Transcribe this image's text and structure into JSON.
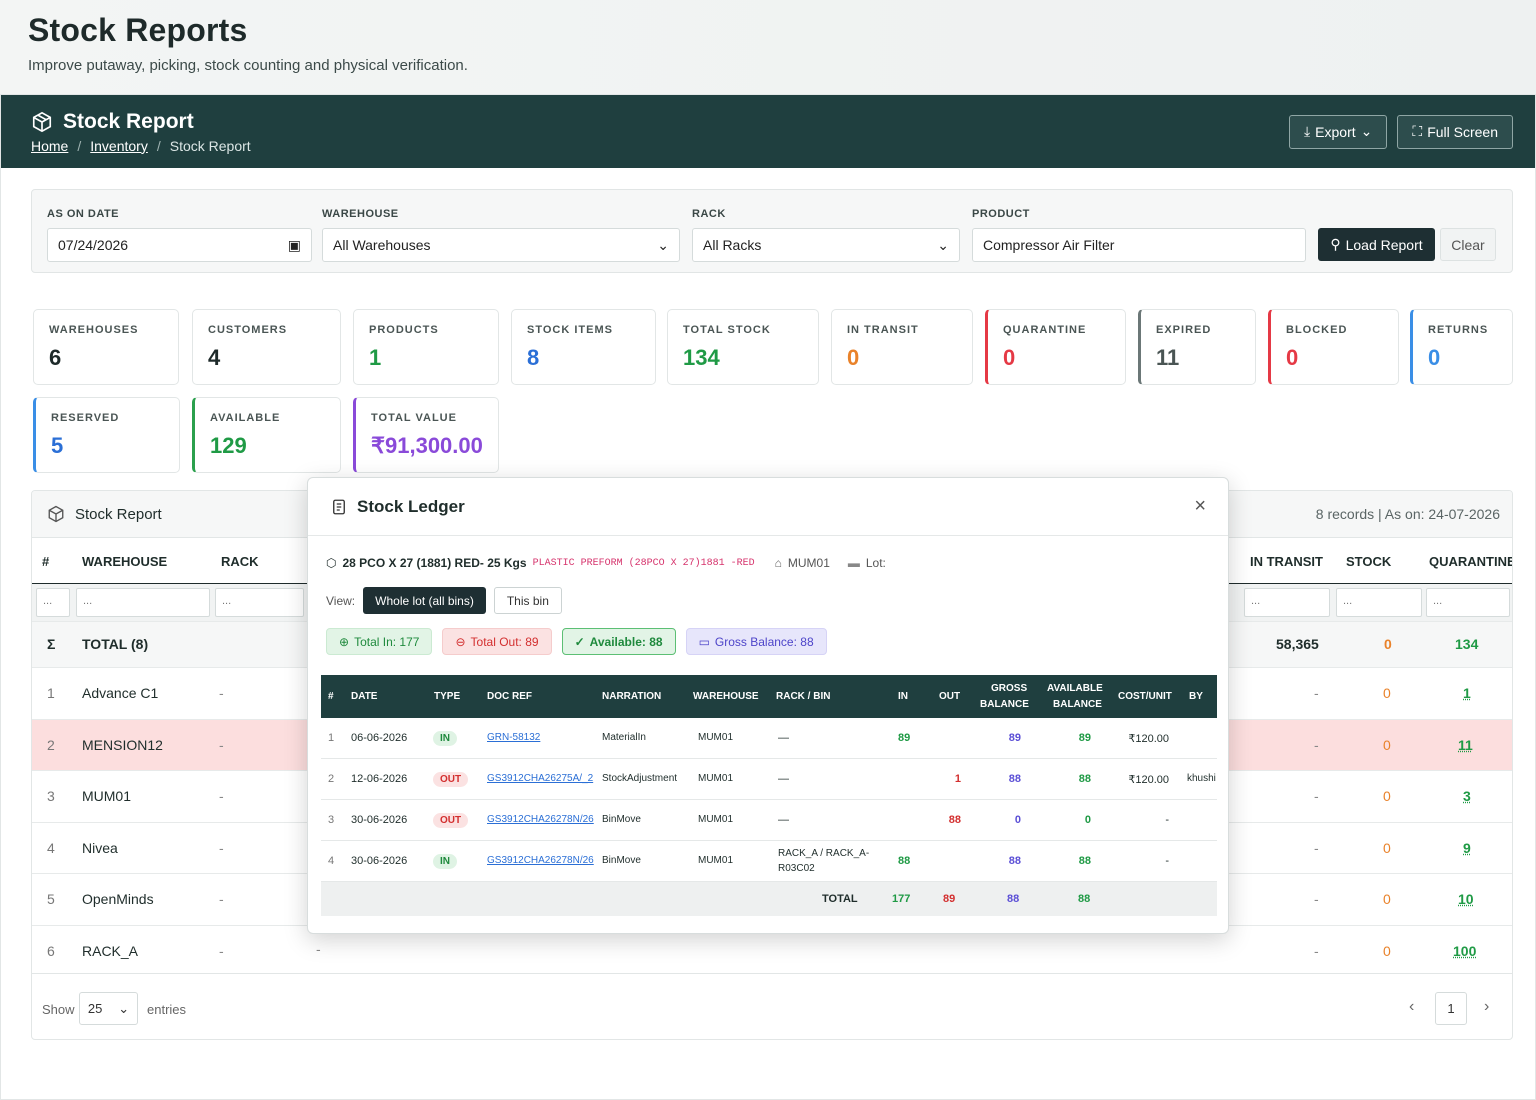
{
  "page": {
    "title": "Stock Reports",
    "subtitle": "Improve putaway, picking, stock counting and physical verification."
  },
  "header": {
    "title": "Stock Report",
    "breadcrumbs": [
      "Home",
      "Inventory",
      "Stock Report"
    ],
    "export_label": "Export",
    "fullscreen_label": "Full Screen"
  },
  "filters": {
    "date": {
      "label": "AS ON DATE",
      "value": "07/24/2026"
    },
    "warehouse": {
      "label": "WAREHOUSE",
      "value": "All Warehouses"
    },
    "rack": {
      "label": "RACK",
      "value": "All Racks"
    },
    "product": {
      "label": "PRODUCT",
      "value": "Compressor Air Filter"
    },
    "load_label": "Load Report",
    "clear_label": "Clear"
  },
  "stats": [
    {
      "label": "WAREHOUSES",
      "value": "6",
      "color": "#1e2a2a"
    },
    {
      "label": "CUSTOMERS",
      "value": "4",
      "color": "#1e2a2a"
    },
    {
      "label": "PRODUCTS",
      "value": "1",
      "color": "#1f9a45"
    },
    {
      "label": "STOCK ITEMS",
      "value": "8",
      "color": "#2b6fd6"
    },
    {
      "label": "TOTAL STOCK",
      "value": "134",
      "color": "#1f9a45"
    },
    {
      "label": "IN TRANSIT",
      "value": "0",
      "color": "#e9822a"
    },
    {
      "label": "QUARANTINE",
      "value": "0",
      "color": "#e53945"
    },
    {
      "label": "EXPIRED",
      "value": "11",
      "color": "#4a5554"
    },
    {
      "label": "BLOCKED",
      "value": "0",
      "color": "#e53945"
    },
    {
      "label": "RETURNS",
      "value": "0",
      "color": "#3a8ee6"
    },
    {
      "label": "RESERVED",
      "value": "5",
      "color": "#2b6fd6"
    },
    {
      "label": "AVAILABLE",
      "value": "129",
      "color": "#1f9a45"
    },
    {
      "label": "TOTAL VALUE",
      "value": "₹91,300.00",
      "color": "#8a4ad9"
    }
  ],
  "report": {
    "title": "Stock Report",
    "meta": "8 records | As on: 24-07-2026",
    "columns": {
      "num": "#",
      "warehouse": "WAREHOUSE",
      "rack": "RACK",
      "in_transit": "IN TRANSIT",
      "stock": "STOCK",
      "quarantine": "QUARANTINE"
    },
    "search_placeholder": "...",
    "total": {
      "sigma": "Σ",
      "label": "TOTAL (8)",
      "value": "58,365",
      "transit": "0",
      "qty": "134"
    },
    "rows": [
      {
        "n": "1",
        "wh": "Advance C1",
        "rack": "-",
        "dash": "-",
        "transit": "0",
        "qty": "1"
      },
      {
        "n": "2",
        "wh": "MENSION12",
        "rack": "-",
        "dash": "-",
        "transit": "0",
        "qty": "11"
      },
      {
        "n": "3",
        "wh": "MUM01",
        "rack": "-",
        "dash": "-",
        "transit": "0",
        "qty": "3"
      },
      {
        "n": "4",
        "wh": "Nivea",
        "rack": "-",
        "dash": "-",
        "transit": "0",
        "qty": "9"
      },
      {
        "n": "5",
        "wh": "OpenMinds",
        "rack": "-",
        "dash": "-",
        "transit": "0",
        "qty": "10"
      },
      {
        "n": "6",
        "wh": "RACK_A",
        "rack": "-",
        "dash": "-",
        "transit": "0",
        "qty": "100"
      }
    ],
    "extra_dash": "-",
    "show_label": "Show",
    "page_size": "25",
    "entries_label": "entries",
    "page": "1"
  },
  "ledger": {
    "title": "Stock Ledger",
    "product_name": "28 PCO X 27 (1881) RED- 25 Kgs",
    "product_code": "PLASTIC PREFORM (28PCO X 27)1881 -RED",
    "warehouse": "MUM01",
    "lot_label": "Lot:",
    "view_label": "View:",
    "view_whole": "Whole lot (all bins)",
    "view_bin": "This bin",
    "total_in": "Total In: 177",
    "total_out": "Total Out: 89",
    "available": "Available: 88",
    "gross_balance": "Gross Balance: 88",
    "columns": {
      "num": "#",
      "date": "DATE",
      "type": "TYPE",
      "doc": "DOC REF",
      "narration": "NARRATION",
      "warehouse": "WAREHOUSE",
      "rack": "RACK / BIN",
      "in": "IN",
      "out": "OUT",
      "gross1": "GROSS",
      "gross2": "BALANCE",
      "avail1": "AVAILABLE",
      "avail2": "BALANCE",
      "cost": "COST/UNIT",
      "by": "BY"
    },
    "rows": [
      {
        "n": "1",
        "date": "06-06-2026",
        "type": "IN",
        "doc": "GRN-58132",
        "narr": "MaterialIn",
        "wh": "MUM01",
        "rack": "—",
        "rack2": "",
        "in": "89",
        "out": "",
        "gross": "89",
        "avail": "89",
        "cost": "₹120.00",
        "by": ""
      },
      {
        "n": "2",
        "date": "12-06-2026",
        "type": "OUT",
        "doc": "GS3912CHA26275A/_2",
        "narr": "StockAdjustment",
        "wh": "MUM01",
        "rack": "—",
        "rack2": "",
        "in": "",
        "out": "1",
        "gross": "88",
        "avail": "88",
        "cost": "₹120.00",
        "by": "khushi"
      },
      {
        "n": "3",
        "date": "30-06-2026",
        "type": "OUT",
        "doc": "GS3912CHA26278N/26",
        "narr": "BinMove",
        "wh": "MUM01",
        "rack": "—",
        "rack2": "",
        "in": "",
        "out": "88",
        "gross": "0",
        "avail": "0",
        "cost": "-",
        "by": ""
      },
      {
        "n": "4",
        "date": "30-06-2026",
        "type": "IN",
        "doc": "GS3912CHA26278N/26",
        "narr": "BinMove",
        "wh": "MUM01",
        "rack": "RACK_A / RACK_A-",
        "rack2": "R03C02",
        "in": "88",
        "out": "",
        "gross": "88",
        "avail": "88",
        "cost": "-",
        "by": ""
      }
    ],
    "totals": {
      "label": "TOTAL",
      "in": "177",
      "out": "89",
      "gross": "88",
      "avail": "88"
    }
  }
}
